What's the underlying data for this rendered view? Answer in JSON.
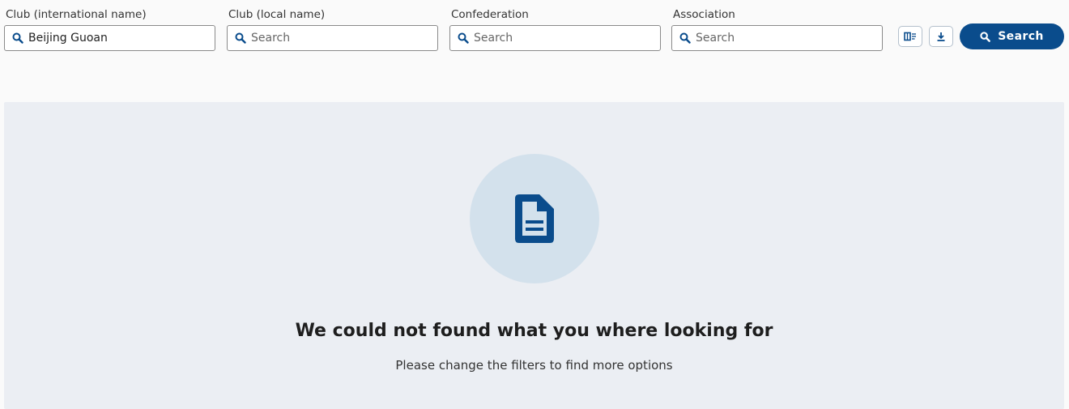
{
  "filters": [
    {
      "label": "Club (international name)",
      "value": "Beijing Guoan",
      "placeholder": "Search"
    },
    {
      "label": "Club (local name)",
      "value": "",
      "placeholder": "Search"
    },
    {
      "label": "Confederation",
      "value": "",
      "placeholder": "Search"
    },
    {
      "label": "Association",
      "value": "",
      "placeholder": "Search"
    }
  ],
  "actions": {
    "columns_icon": "table-columns-icon",
    "download_icon": "download-icon",
    "search_label": "Search"
  },
  "empty_state": {
    "icon": "document-icon",
    "title": "We could not found what you where looking for",
    "subtitle": "Please change the filters to find more options"
  },
  "colors": {
    "primary": "#0a4c8c",
    "panel_bg": "#ebeef3",
    "circle_bg": "#d3e1ec"
  }
}
